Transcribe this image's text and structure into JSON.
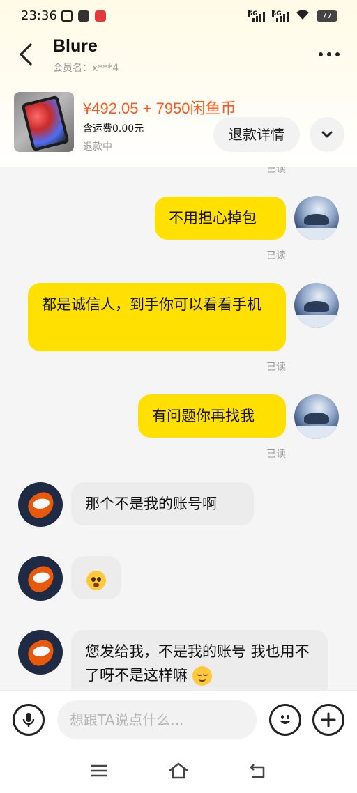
{
  "status_bar": {
    "time": "23:36",
    "signal_label_1": "5G",
    "signal_label_2": "5G",
    "battery": "77"
  },
  "header": {
    "title": "Blure",
    "member_label": "会员名：x***4"
  },
  "product": {
    "price": "¥492.05 + 7950闲鱼币",
    "shipping": "含运费0.00元",
    "status": "退款中",
    "refund_button_label": "退款详情"
  },
  "messages": [
    {
      "sender": "me",
      "text": "不用担心掉包",
      "read": "已读"
    },
    {
      "sender": "me",
      "text": "都是诚信人，到手你可以看看手机",
      "read": "已读"
    },
    {
      "sender": "me",
      "text": "有问题你再找我",
      "read": "已读"
    },
    {
      "sender": "other",
      "text": "那个不是我的账号啊"
    },
    {
      "sender": "other",
      "emoji": "flushed-face-icon"
    },
    {
      "sender": "other",
      "text": "您发给我，不是我的账号 我也用不了呀不是这样嘛",
      "emoji": "relieved-face-icon"
    }
  ],
  "top_partial_read": "已读",
  "input": {
    "placeholder": "想跟TA说点什么..."
  },
  "colors": {
    "my_bubble": "#ffe000",
    "other_bubble": "#ececec",
    "price": "#ff5722"
  }
}
